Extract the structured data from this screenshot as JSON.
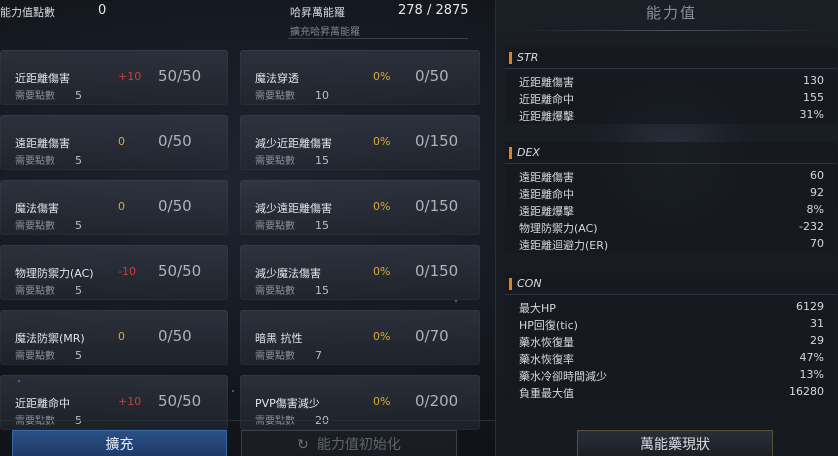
{
  "top": {
    "points_label": "能力值點數",
    "points_value": "0",
    "exp_label": "哈昇萬能羅",
    "exp_value": "278 / 2875",
    "exp_sub": "擴充哈昇萬能羅"
  },
  "cards_left": [
    {
      "name": "近距離傷害",
      "bonus": "+10",
      "bonus_color": "red",
      "level": "50/50",
      "req_label": "需要點數",
      "req": "5"
    },
    {
      "name": "遠距離傷害",
      "bonus": "0",
      "bonus_color": "gold",
      "level": "0/50",
      "req_label": "需要點數",
      "req": "5"
    },
    {
      "name": "魔法傷害",
      "bonus": "0",
      "bonus_color": "gold",
      "level": "0/50",
      "req_label": "需要點數",
      "req": "5"
    },
    {
      "name": "物理防禦力(AC)",
      "bonus": "-10",
      "bonus_color": "red",
      "level": "50/50",
      "req_label": "需要點數",
      "req": "5"
    },
    {
      "name": "魔法防禦(MR)",
      "bonus": "0",
      "bonus_color": "gold",
      "level": "0/50",
      "req_label": "需要點數",
      "req": "5"
    },
    {
      "name": "近距離命中",
      "bonus": "+10",
      "bonus_color": "red",
      "level": "50/50",
      "req_label": "需要點數",
      "req": "5"
    }
  ],
  "cards_mid": [
    {
      "name": "魔法穿透",
      "bonus": "0%",
      "level": "0/50",
      "req_label": "需要點數",
      "req": "10"
    },
    {
      "name": "減少近距離傷害",
      "bonus": "0%",
      "level": "0/150",
      "req_label": "需要點數",
      "req": "15"
    },
    {
      "name": "減少遠距離傷害",
      "bonus": "0%",
      "level": "0/150",
      "req_label": "需要點數",
      "req": "15"
    },
    {
      "name": "減少魔法傷害",
      "bonus": "0%",
      "level": "0/150",
      "req_label": "需要點數",
      "req": "15"
    },
    {
      "name": "暗黑 抗性",
      "bonus": "0%",
      "level": "0/70",
      "req_label": "需要點數",
      "req": "7"
    },
    {
      "name": "PVP傷害減少",
      "bonus": "0%",
      "level": "0/200",
      "req_label": "需要點數",
      "req": "20"
    }
  ],
  "panel": {
    "title": "能力值",
    "str": {
      "head": "STR",
      "rows": [
        {
          "k": "近距離傷害",
          "v": "130"
        },
        {
          "k": "近距離命中",
          "v": "155"
        },
        {
          "k": "近距離爆擊",
          "v": "31%"
        }
      ]
    },
    "dex": {
      "head": "DEX",
      "rows": [
        {
          "k": "遠距離傷害",
          "v": "60"
        },
        {
          "k": "遠距離命中",
          "v": "92"
        },
        {
          "k": "遠距離爆擊",
          "v": "8%"
        },
        {
          "k": "物理防禦力(AC)",
          "v": "-232"
        },
        {
          "k": "遠距離迴避力(ER)",
          "v": "70"
        }
      ]
    },
    "con": {
      "head": "CON",
      "rows": [
        {
          "k": "最大HP",
          "v": "6129"
        },
        {
          "k": "HP回復(tic)",
          "v": "31"
        },
        {
          "k": "藥水恢復量",
          "v": "29"
        },
        {
          "k": "藥水恢復率",
          "v": "47%"
        },
        {
          "k": "藥水冷卻時間減少",
          "v": "13%"
        },
        {
          "k": "負重最大值",
          "v": "16280"
        }
      ]
    }
  },
  "buttons": {
    "expand": "擴充",
    "reset": "能力值初始化",
    "potion": "萬能藥現狀"
  },
  "colors": {
    "red": "#d23a3a",
    "gold": "#d8a93a",
    "accent": "#d8822c",
    "blue": "#2a4f86"
  }
}
